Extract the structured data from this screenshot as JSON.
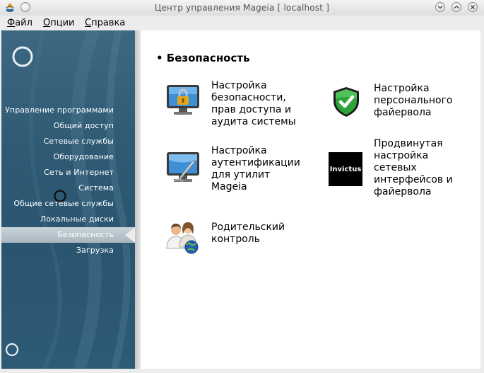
{
  "window": {
    "title": "Центр управления Mageia  [ localhost ]"
  },
  "menubar": {
    "items": [
      {
        "first": "Ф",
        "rest": "айл"
      },
      {
        "first": "О",
        "rest": "пции"
      },
      {
        "first": "С",
        "rest": "правка"
      }
    ]
  },
  "sidebar": {
    "items": [
      "Управление программами",
      "Общий доступ",
      "Сетевые службы",
      "Оборудование",
      "Сеть и Интернет",
      "Система",
      "Общие сетевые службы",
      "Локальные диски",
      "Безопасность",
      "Загрузка"
    ],
    "selected_index": 8
  },
  "content": {
    "section_title": "• Безопасность",
    "tools": [
      {
        "label": "Настройка\nбезопасности,\nправ доступа и\nаудита системы",
        "icon": "monitor-lock-icon"
      },
      {
        "label": "Настройка\nперсонального\nфайервола",
        "icon": "shield-check-icon"
      },
      {
        "label": "Настройка\nаутентификации\nдля утилит\nMageia",
        "icon": "monitor-pen-icon"
      },
      {
        "label": "Продвинутая\nнастройка\nсетевых\nинтерфейсов и\nфайервола",
        "icon": "invictus-logo",
        "logo_text": "Invictus"
      },
      {
        "label": "Родительский\nконтроль",
        "icon": "parents-globe-icon"
      }
    ]
  },
  "colors": {
    "sidebar": "#2e5a74",
    "selected": "#b3bfc7",
    "content_bg": "#ffffff"
  }
}
